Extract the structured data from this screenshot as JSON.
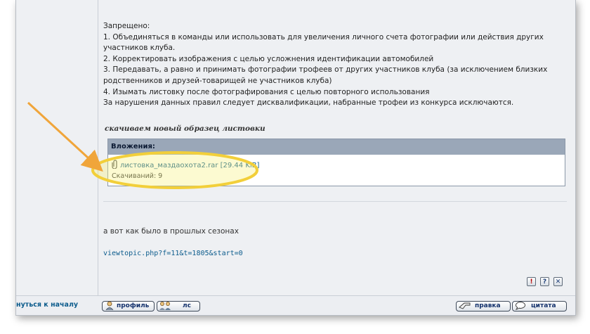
{
  "post": {
    "heading": "Запрещено:",
    "rules": [
      "1. Объединяться в команды или использовать для увеличения личного счета фотографии или действия других участников клуба.",
      "2. Корректировать изображения с целью усложнения идентификации автомобилей",
      "3. Передавать, а равно и принимать фотографии трофеев от других участников клуба (за исключением близких родственников и друзей-товарищей не участников клуба)",
      "4. Изымать листовку после фотографирования с целью повторного использования"
    ],
    "penalty": "За нарушения данных правил следует дисквалификации, набранные трофеи из конкурса исключаются.",
    "download_title": "скачиваем новый образец листовки",
    "attachment": {
      "header": "Вложения:",
      "filename": "листовка_маздаохота2.rar",
      "size": "[29.44 KiB]",
      "downloads": "Скачиваний: 9"
    },
    "past_text": "а вот как было в прошлых сезонах",
    "link": "viewtopic.php?f=11&t=1805&start=0"
  },
  "footer": {
    "back_to_top": "нуться к началу",
    "profile": "профиль",
    "pm": "лс",
    "edit": "правка",
    "quote": "цитата"
  },
  "icons": {
    "report": "!",
    "info": "?",
    "delete": "✕"
  },
  "colors": {
    "link": "#0b5b8c",
    "attach_header": "#9aa7b8",
    "highlight": "#f2cf3a",
    "arrow": "#f0a53a"
  }
}
